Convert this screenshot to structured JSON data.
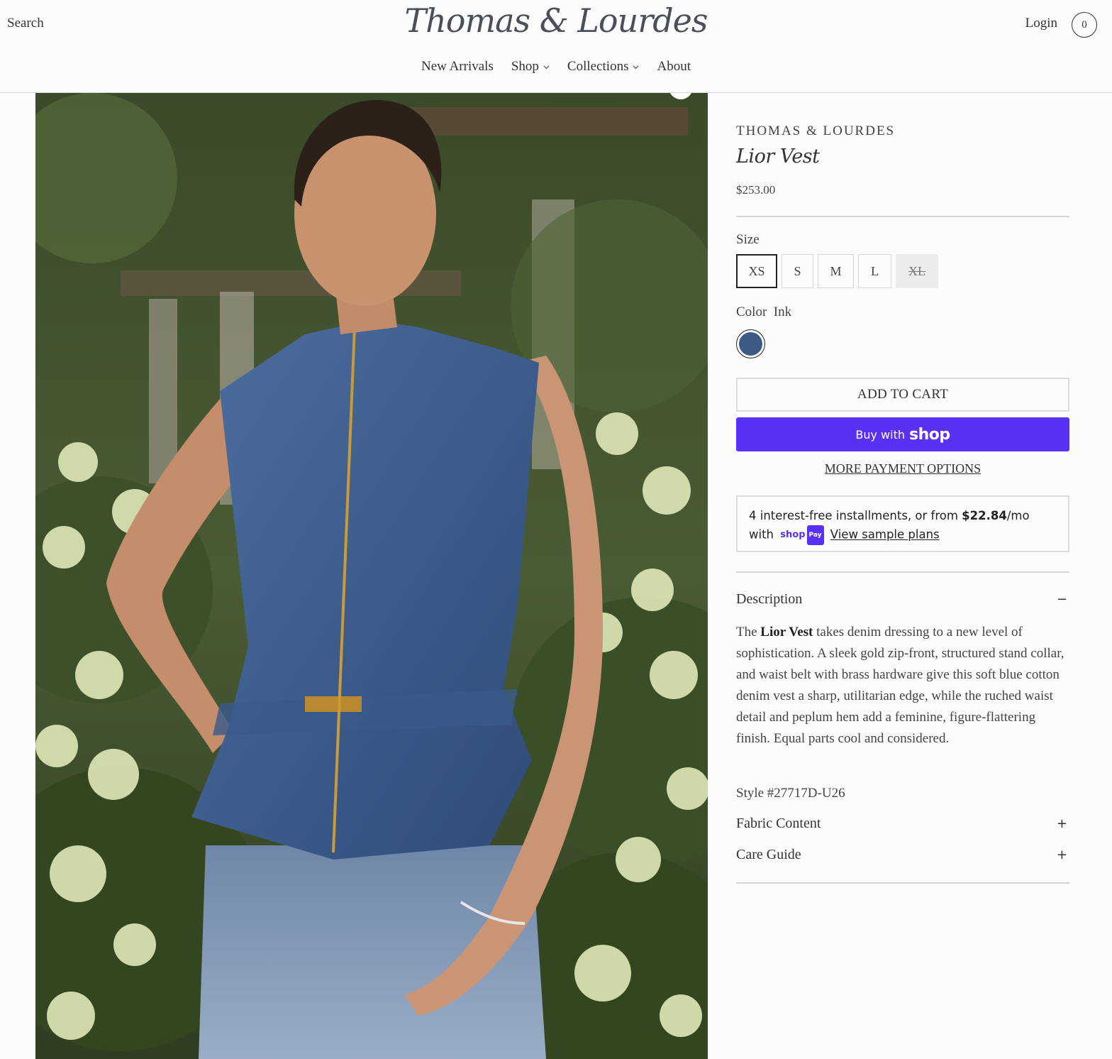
{
  "header": {
    "search_label": "Search",
    "logo_text": "Thomas & Lourdes",
    "login_label": "Login",
    "cart_count": "0"
  },
  "nav": {
    "items": [
      {
        "label": "New Arrivals"
      },
      {
        "label": "Shop"
      },
      {
        "label": "Collections"
      },
      {
        "label": "About"
      }
    ]
  },
  "product": {
    "vendor": "THOMAS & LOURDES",
    "title": "Lior Vest",
    "price": "$253.00",
    "size_label": "Size",
    "sizes": [
      "XS",
      "S",
      "M",
      "L",
      "XL"
    ],
    "selected_size": "XS",
    "soldout_sizes": [
      "XL"
    ],
    "color_label": "Color",
    "color_value": "Ink",
    "swatch_color": "#3d5a85",
    "add_to_cart": "ADD TO CART",
    "buy_with": "Buy with",
    "shop_word": "shop",
    "more_payment": "MORE PAYMENT OPTIONS",
    "installments": {
      "line1_pre": "4 interest-free installments, or from ",
      "amount": "$22.84",
      "line1_post": "/mo",
      "with": "with",
      "badge_shop": "shop",
      "badge_pay": "Pay",
      "view_plans": "View sample plans"
    },
    "description_heading": "Description",
    "description": {
      "pre": "The ",
      "bold": "Lior Vest",
      "post": " takes denim dressing to a new level of sophistication. A sleek gold zip-front, structured stand collar, and waist belt with brass hardware give this soft blue cotton denim vest a sharp, utilitarian edge, while the ruched waist detail and peplum hem add a feminine, figure-flattering finish. Equal parts cool and considered."
    },
    "style_number": "Style #27717D-U26",
    "fabric_heading": "Fabric Content",
    "care_heading": "Care Guide",
    "collapse_sign": "−",
    "expand_sign": "+"
  },
  "colors": {
    "brand_purple": "#5a31f4",
    "denim": "#3d5a85"
  }
}
